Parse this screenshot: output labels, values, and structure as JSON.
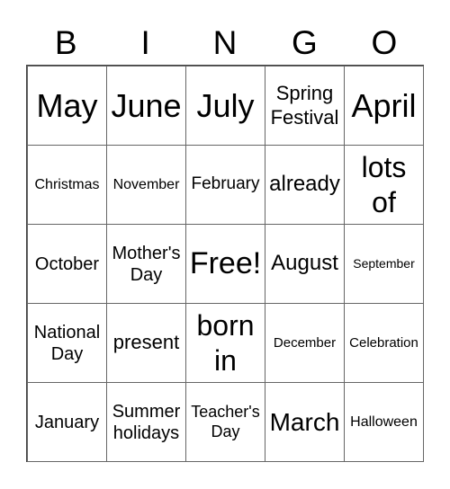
{
  "header": [
    "B",
    "I",
    "N",
    "G",
    "O"
  ],
  "cells": [
    "May",
    "June",
    "July",
    "Spring\nFestival",
    "April",
    "Christmas",
    "November",
    "February",
    "already",
    "lots\nof",
    "October",
    "Mother's\nDay",
    "Free!",
    "August",
    "September",
    "National\nDay",
    "present",
    "born\nin",
    "December",
    "Celebration",
    "January",
    "Summer\nholidays",
    "Teacher's\nDay",
    "March",
    "Halloween"
  ]
}
